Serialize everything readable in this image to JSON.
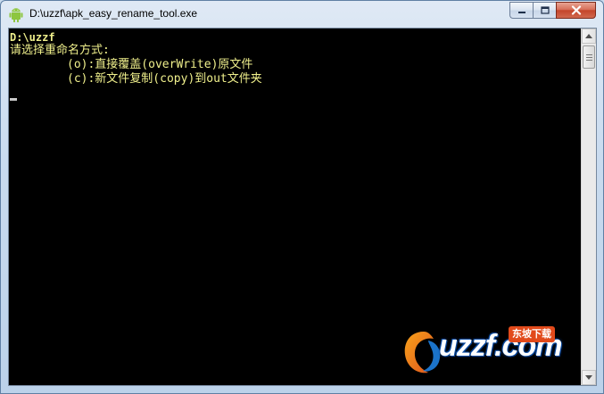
{
  "window": {
    "title": "D:\\uzzf\\apk_easy_rename_tool.exe",
    "icon": "android-icon"
  },
  "caption_buttons": {
    "minimize_icon": "minimize-icon",
    "maximize_icon": "maximize-icon",
    "close_icon": "close-icon"
  },
  "console": {
    "lines": [
      "D:\\uzzf",
      "请选择重命名方式:",
      "(o):直接覆盖(overWrite)原文件",
      "(c):新文件复制(copy)到out文件夹"
    ],
    "text_color": "#f0f08c",
    "background": "#000000"
  },
  "watermark": {
    "text": "uzzf.com",
    "badge": "东坡下载"
  }
}
